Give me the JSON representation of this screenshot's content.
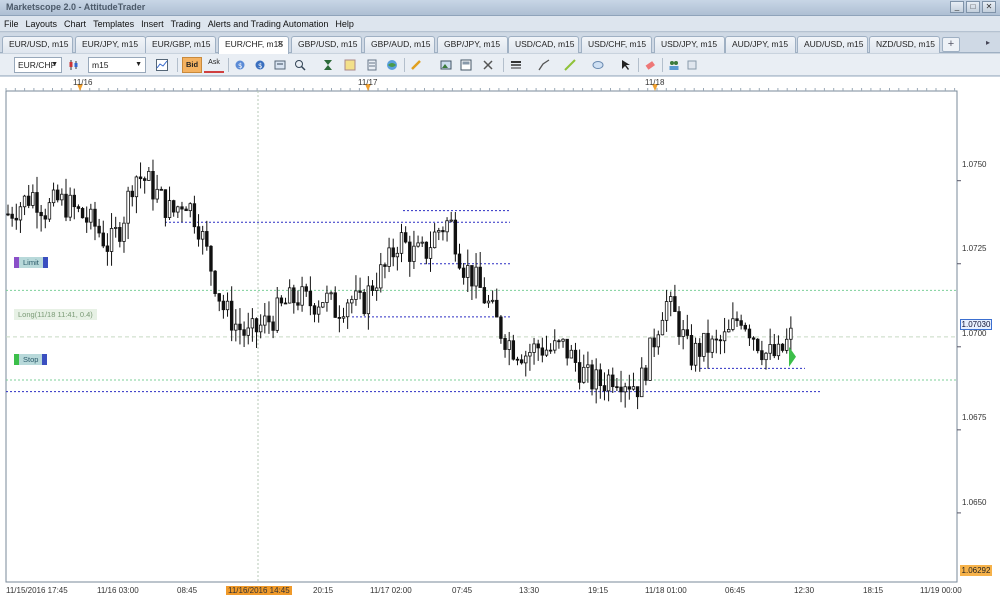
{
  "window": {
    "title": "Marketscope 2.0 - AttitudeTrader",
    "buttons": [
      "_",
      "□",
      "✕"
    ]
  },
  "menu": [
    "File",
    "Layouts",
    "Chart",
    "Templates",
    "Insert",
    "Trading",
    "Alerts and Trading Automation",
    "Help"
  ],
  "tabs": [
    {
      "label": "EUR/USD, m15",
      "active": false
    },
    {
      "label": "EUR/JPY, m15",
      "active": false
    },
    {
      "label": "EUR/GBP, m15",
      "active": false
    },
    {
      "label": "EUR/CHF, m15",
      "active": true
    },
    {
      "label": "GBP/USD, m15",
      "active": false
    },
    {
      "label": "GBP/AUD, m15",
      "active": false
    },
    {
      "label": "GBP/JPY, m15",
      "active": false
    },
    {
      "label": "USD/CAD, m15",
      "active": false
    },
    {
      "label": "USD/CHF, m15",
      "active": false
    },
    {
      "label": "USD/JPY, m15",
      "active": false
    },
    {
      "label": "AUD/JPY, m15",
      "active": false
    },
    {
      "label": "AUD/USD, m15",
      "active": false
    },
    {
      "label": "NZD/USD, m15",
      "active": false
    }
  ],
  "tab_add": "+",
  "toolbar": {
    "instrument": "EUR/CHF",
    "timeframe": "m15",
    "bid_label": "Bid",
    "ask_label": "Ask"
  },
  "chart": {
    "date_markers": [
      "11/16",
      "11/17",
      "11/18"
    ],
    "price_labels": [
      "1.0750",
      "1.0725",
      "1.0700",
      "1.0675",
      "1.0650"
    ],
    "last_price": "1.07030",
    "min_price": "1.06292",
    "time_labels": [
      "11/15/2016 17:45",
      "11/16 03:00",
      "08:45",
      "11/16/2016 14:45",
      "20:15",
      "11/17 02:00",
      "07:45",
      "13:30",
      "19:15",
      "11/18 01:00",
      "06:45",
      "12:30",
      "18:15",
      "11/19 00:00"
    ],
    "orders": {
      "limit_label": "Limit",
      "position_label": "Long(11/18 11:41, 0.4)",
      "stop_label": "Stop"
    },
    "colors": {
      "limit": "#8a4fc8",
      "stop": "#3cbf4a",
      "level": "#2c2fc4",
      "order_line": "#7ccf9a"
    }
  },
  "chart_data": {
    "type": "candlestick",
    "title": "",
    "xlabel": "",
    "ylabel": "",
    "ylim": [
      1.06292,
      1.0777
    ],
    "ticks": [
      1.075,
      1.0725,
      1.07,
      1.0675,
      1.065
    ],
    "close_series": [
      1.074,
      1.0743,
      1.0746,
      1.0741,
      1.0744,
      1.0742,
      1.0739,
      1.0736,
      1.073,
      1.0737,
      1.0752,
      1.075,
      1.0745,
      1.074,
      1.0745,
      1.0738,
      1.0725,
      1.0712,
      1.0707,
      1.0703,
      1.0706,
      1.0709,
      1.0713,
      1.0715,
      1.0713,
      1.0715,
      1.0711,
      1.0715,
      1.0712,
      1.072,
      1.0724,
      1.0733,
      1.0728,
      1.0728,
      1.0735,
      1.0738,
      1.0725,
      1.072,
      1.0713,
      1.0705,
      1.07,
      1.0698,
      1.07,
      1.0699,
      1.07,
      1.0695,
      1.069,
      1.0689,
      1.0692,
      1.069,
      1.0688,
      1.07,
      1.0714,
      1.0708,
      1.0697,
      1.07,
      1.07,
      1.0703,
      1.071,
      1.0704,
      1.0698,
      1.0697,
      1.0703
    ],
    "levels": [
      1.07375,
      1.0706,
      1.0689
    ]
  }
}
